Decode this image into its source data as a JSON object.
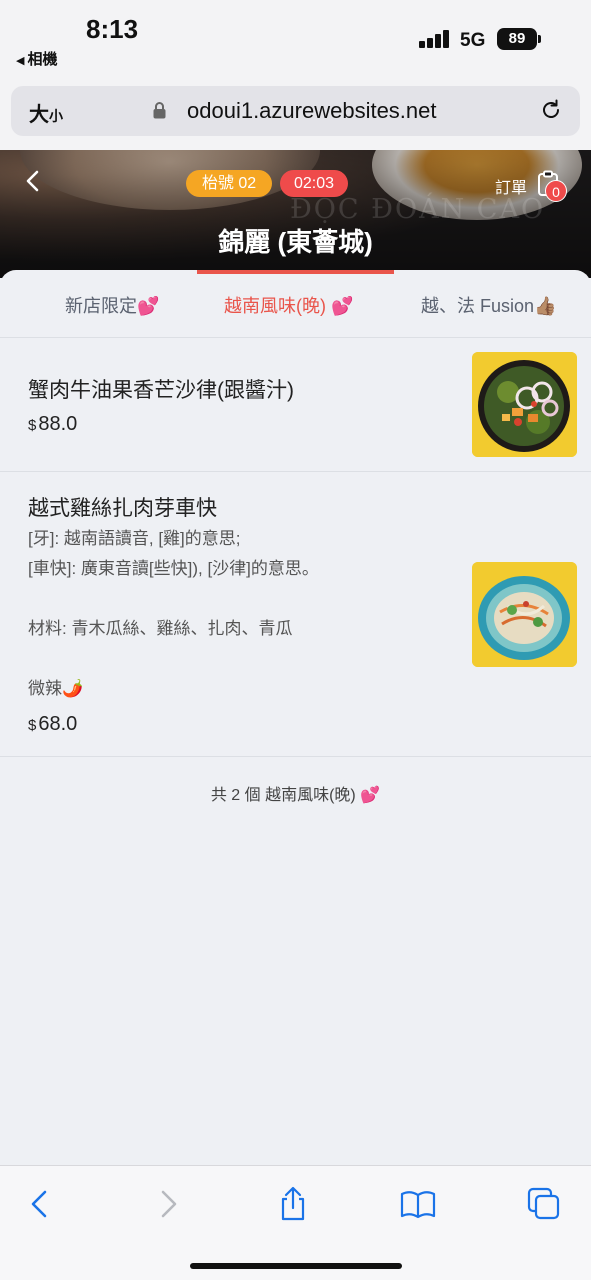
{
  "status_bar": {
    "time": "8:13",
    "back_app": "相機",
    "network": "5G",
    "battery": "89"
  },
  "browser": {
    "text_size_label": "大",
    "text_size_small": "小",
    "url": "odoui1.azurewebsites.net"
  },
  "header": {
    "table_label": "枱號 02",
    "timer": "02:03",
    "order_label": "訂單",
    "order_count": "0",
    "restaurant_name": "錦麗 (東薈城)",
    "background_text": "ĐỘC ĐOÁN CAO"
  },
  "tabs": [
    {
      "label": "新店限定💕",
      "active": false
    },
    {
      "label": "越南風味(晚) 💕",
      "active": true
    },
    {
      "label": "越、法 Fusion👍🏽",
      "active": false
    }
  ],
  "menu_items": [
    {
      "name": "蟹肉牛油果香芒沙律(跟醬汁)",
      "description": "",
      "currency": "$",
      "price": "88.0"
    },
    {
      "name": "越式雞絲扎肉芽車快",
      "description": "[牙]: 越南語讀音, [雞]的意思;\n [車快]: 廣東音讀[些快]), [沙律]的意思。\n\n材料: 青木瓜絲、雞絲、扎肉、青瓜\n\n微辣🌶️",
      "currency": "$",
      "price": "68.0"
    }
  ],
  "summary": "共 2 個 越南風味(晚) 💕",
  "colors": {
    "accent": "#e9554b",
    "table_pill": "#f5a623",
    "timer_pill": "#ef4b4b",
    "ios_blue": "#1a73e8"
  }
}
